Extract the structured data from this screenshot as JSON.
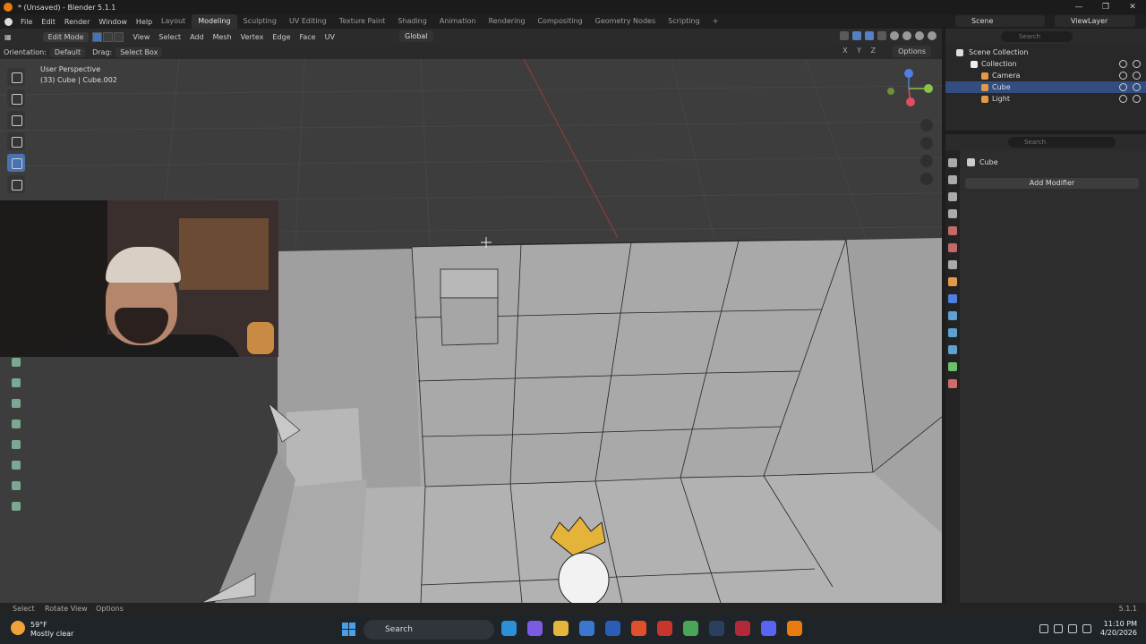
{
  "title_bar": {
    "title": "* (Unsaved) - Blender 5.1.1"
  },
  "menu": [
    "File",
    "Edit",
    "Render",
    "Window",
    "Help"
  ],
  "workspaces": [
    "Layout",
    "Modeling",
    "Sculpting",
    "UV Editing",
    "Texture Paint",
    "Shading",
    "Animation",
    "Rendering",
    "Compositing",
    "Geometry Nodes",
    "Scripting"
  ],
  "active_workspace": "Modeling",
  "scene": {
    "name": "Scene",
    "view_layer": "ViewLayer"
  },
  "viewport_header": {
    "mode": "Edit Mode",
    "menus": [
      "View",
      "Select",
      "Add",
      "Mesh",
      "Vertex",
      "Edge",
      "Face",
      "UV"
    ],
    "transform_orientation": "Global"
  },
  "tool_header": {
    "orientation_label": "Orientation:",
    "orientation_value": "Default",
    "drag_label": "Drag:",
    "drag_value": "Select Box",
    "options": "Options",
    "axes": "X Y Z"
  },
  "viewport": {
    "view_name": "User Perspective",
    "object_info": "(33) Cube | Cube.002"
  },
  "outliner": {
    "search_placeholder": "Search",
    "items": [
      {
        "label": "Scene Collection",
        "selected": false
      },
      {
        "label": "Collection",
        "selected": false
      },
      {
        "label": "Camera",
        "selected": false
      },
      {
        "label": "Cube",
        "selected": true
      },
      {
        "label": "Light",
        "selected": false
      }
    ]
  },
  "properties": {
    "search_placeholder": "Search",
    "object_name": "Cube",
    "add_modifier": "Add Modifier"
  },
  "statusbar": {
    "select": "Select",
    "rotate": "Rotate View",
    "options": "Options",
    "version": "5.1.1"
  },
  "taskbar": {
    "temperature": "59°F",
    "weather": "Mostly clear",
    "search": "Search",
    "time": "11:10 PM",
    "date": "4/20/2026"
  },
  "colors": {
    "accent_blue": "#4772b3",
    "viewport_bg": "#3d3d3d",
    "mesh_face": "#a8a8a8",
    "selected_row": "#334d80"
  }
}
